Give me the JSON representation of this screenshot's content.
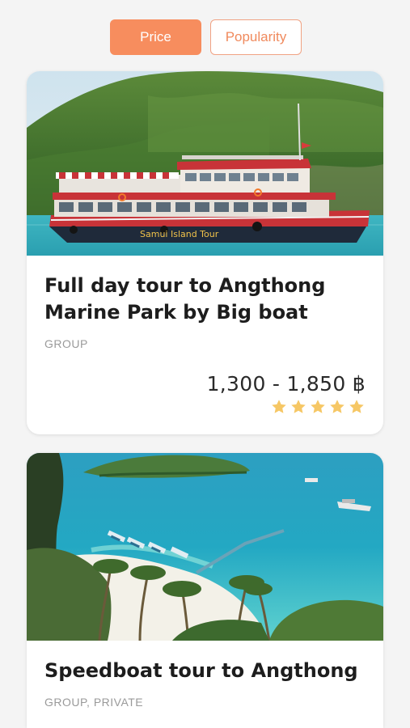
{
  "sort": {
    "price_label": "Price",
    "popularity_label": "Popularity",
    "active": "price"
  },
  "tours": [
    {
      "title": "Full day tour to Angthong Marine Park by Big boat",
      "category": "GROUP",
      "price": "1,300 - 1,850 ฿",
      "rating": 5,
      "boat_sign": "Samui Island Tour"
    },
    {
      "title": "Speedboat tour to Angthong",
      "category": "GROUP, PRIVATE"
    }
  ],
  "colors": {
    "accent": "#f78d5e",
    "star": "#f6c765",
    "background": "#f4f4f4"
  },
  "icons": {
    "rating": "star-icon"
  }
}
